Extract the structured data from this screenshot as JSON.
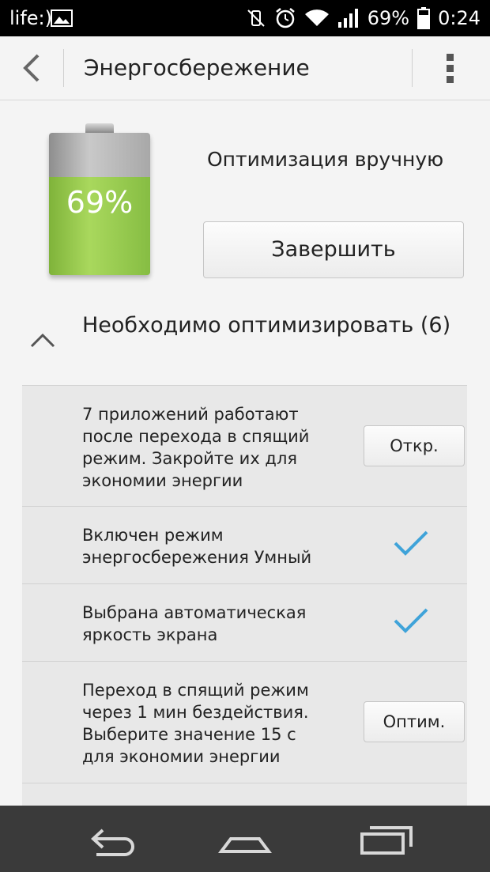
{
  "status_bar": {
    "carrier": "life:)",
    "battery": "69%",
    "time": "0:24"
  },
  "action_bar": {
    "title": "Энергосбережение"
  },
  "battery": {
    "percent_label": "69%",
    "level": 0.69,
    "mode": "Оптимизация вручную",
    "finish_button": "Завершить"
  },
  "section": {
    "title": "Необходимо оптимизировать (6)"
  },
  "items": [
    {
      "text": "7 приложений работают после перехода в спящий режим. Закройте их для экономии энергии",
      "button": "Откр."
    },
    {
      "text": "Включен режим энергосбережения Умный",
      "status": "done"
    },
    {
      "text": "Выбрана автоматическая яркость экрана",
      "status": "done"
    },
    {
      "text": "Переход в спящий режим через 1 мин бездействия. Выберите значение 15 с для экономии энергии",
      "button": "Оптим."
    }
  ],
  "colors": {
    "accent": "#3fa3d9",
    "battery_green": "#9cd255"
  }
}
